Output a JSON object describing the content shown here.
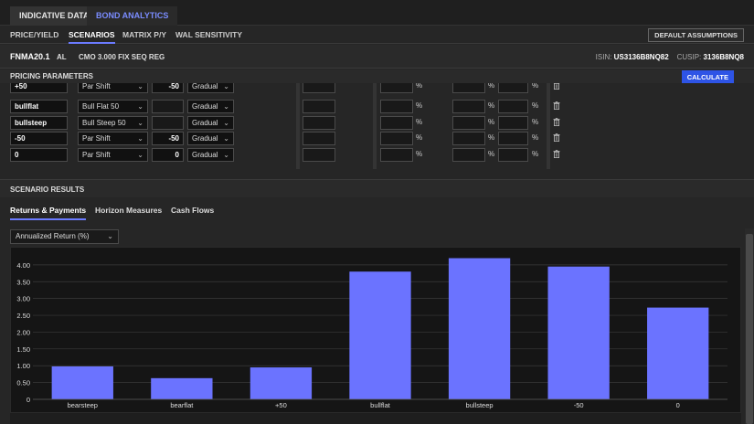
{
  "top_tabs": [
    {
      "label": "INDICATIVE DATA",
      "active": false
    },
    {
      "label": "BOND ANALYTICS",
      "active": true
    }
  ],
  "sub_tabs": [
    {
      "label": "PRICE/YIELD",
      "active": false
    },
    {
      "label": "SCENARIOS",
      "active": true
    },
    {
      "label": "MATRIX P/Y",
      "active": false
    },
    {
      "label": "WAL SENSITIVITY",
      "active": false
    }
  ],
  "default_assumptions_label": "DEFAULT ASSUMPTIONS",
  "instrument": {
    "name": "FNMA20.1",
    "type": "AL",
    "description": "CMO 3.000 FIX SEQ REG",
    "isin_label": "ISIN:",
    "isin": "US3136B8NQ82",
    "cusip_label": "CUSIP:",
    "cusip": "3136B8NQ8"
  },
  "pricing_parameters": {
    "title": "PRICING PARAMETERS",
    "calculate_label": "CALCULATE",
    "percent_sign": "%",
    "rows": [
      {
        "name": "+50",
        "shift": "Par Shift",
        "amount": "-50",
        "mode": "Gradual"
      },
      {
        "name": "bullflat",
        "shift": "Bull Flat 50",
        "amount": "",
        "mode": "Gradual"
      },
      {
        "name": "bullsteep",
        "shift": "Bull Steep 50",
        "amount": "",
        "mode": "Gradual"
      },
      {
        "name": "-50",
        "shift": "Par Shift",
        "amount": "-50",
        "mode": "Gradual"
      },
      {
        "name": "0",
        "shift": "Par Shift",
        "amount": "0",
        "mode": "Gradual"
      }
    ]
  },
  "scenario_results": {
    "title": "SCENARIO RESULTS",
    "tabs": [
      {
        "label": "Returns & Payments",
        "active": true
      },
      {
        "label": "Horizon Measures",
        "active": false
      },
      {
        "label": "Cash Flows",
        "active": false
      }
    ],
    "metric_selected": "Annualized Return (%)"
  },
  "chart_data": {
    "type": "bar",
    "categories": [
      "bearsteep",
      "bearflat",
      "+50",
      "bullflat",
      "bullsteep",
      "-50",
      "0"
    ],
    "values": [
      0.98,
      0.63,
      0.95,
      3.8,
      4.2,
      3.95,
      2.73
    ],
    "yticks": [
      "0",
      "0.50",
      "1.00",
      "1.50",
      "2.00",
      "2.50",
      "3.00",
      "3.50",
      "4.00"
    ],
    "ylim": [
      0,
      4.35
    ],
    "bar_color": "#6b73ff",
    "grid": true
  }
}
